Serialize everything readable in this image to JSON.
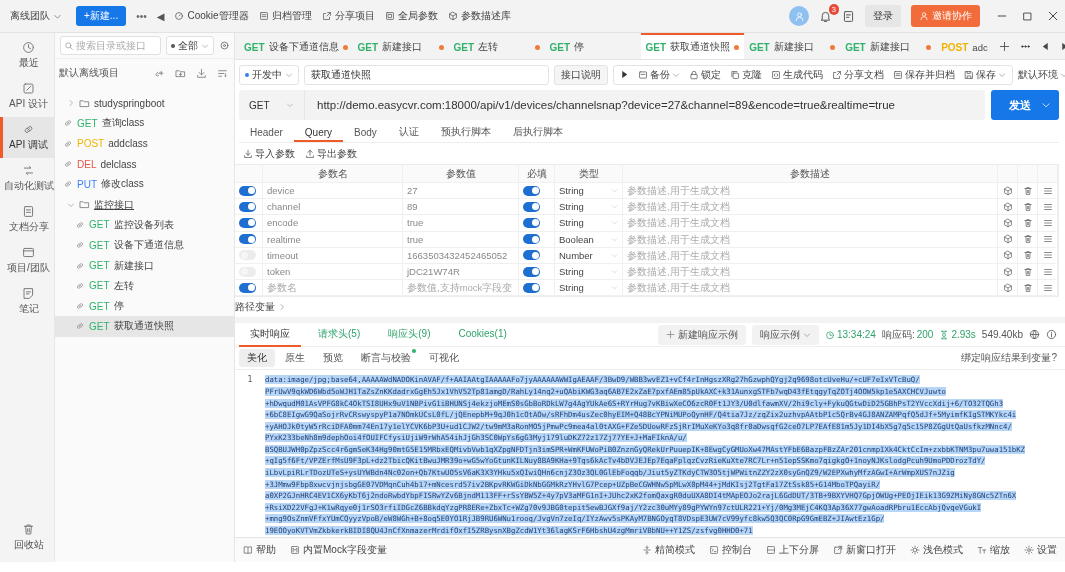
{
  "top_bar": {
    "team": "离线团队",
    "new_button": "+新建...",
    "more": "•••",
    "back": "◀",
    "menu": [
      "Cookie管理器",
      "归档管理",
      "分享项目",
      "全局参数",
      "参数描述库"
    ],
    "notification_count": "3",
    "login": "登录",
    "invite": "邀请协作"
  },
  "sidebar_rail": {
    "items": [
      {
        "label": "最近",
        "selected": false
      },
      {
        "label": "API 设计",
        "selected": false
      },
      {
        "label": "API 调试",
        "selected": true
      },
      {
        "label": "自动化测试",
        "selected": false
      },
      {
        "label": "文档分享",
        "selected": false
      },
      {
        "label": "项目/团队",
        "selected": false
      },
      {
        "label": "笔记",
        "selected": false
      }
    ],
    "bottom": "回收站"
  },
  "tree": {
    "search_placeholder": "搜索目录或接口",
    "filter": "全部",
    "project": "默认离线项目",
    "items": [
      {
        "kind": "folder",
        "name": "studyspringboot",
        "expanded": false
      },
      {
        "kind": "api",
        "method": "GET",
        "color": "#2fb36b",
        "name": "查询class",
        "selected": false
      },
      {
        "kind": "api",
        "method": "POST",
        "color": "#f0b400",
        "name": "addclass",
        "selected": false
      },
      {
        "kind": "api",
        "method": "DEL",
        "color": "#e0564b",
        "name": "delclass",
        "selected": false
      },
      {
        "kind": "api",
        "method": "PUT",
        "color": "#3b82f6",
        "name": "修改class",
        "selected": false
      },
      {
        "kind": "folder",
        "name": "监控接口",
        "expanded": true,
        "children": [
          {
            "kind": "api",
            "method": "GET",
            "color": "#2fb36b",
            "name": "监控设备列表",
            "selected": false
          },
          {
            "kind": "api",
            "method": "GET",
            "color": "#2fb36b",
            "name": "设备下通道信息",
            "selected": false
          },
          {
            "kind": "api",
            "method": "GET",
            "color": "#2fb36b",
            "name": "新建接口",
            "selected": false
          },
          {
            "kind": "api",
            "method": "GET",
            "color": "#2fb36b",
            "name": "左转",
            "selected": false
          },
          {
            "kind": "api",
            "method": "GET",
            "color": "#2fb36b",
            "name": "停",
            "selected": false
          },
          {
            "kind": "api",
            "method": "GET",
            "color": "#2fb36b",
            "name": "获取通道快照",
            "selected": true
          }
        ]
      }
    ]
  },
  "open_tabs": [
    {
      "method": "GET",
      "color": "#2fb36b",
      "name": "设备下通道信息",
      "unsaved": true,
      "selected": false
    },
    {
      "method": "GET",
      "color": "#2fb36b",
      "name": "新建接口",
      "unsaved": true,
      "selected": false
    },
    {
      "method": "GET",
      "color": "#2fb36b",
      "name": "左转",
      "unsaved": true,
      "selected": false
    },
    {
      "method": "GET",
      "color": "#2fb36b",
      "name": "停",
      "unsaved": false,
      "selected": false
    },
    {
      "method": "GET",
      "color": "#2fb36b",
      "name": "获取通道快照",
      "unsaved": true,
      "selected": true
    },
    {
      "method": "GET",
      "color": "#2fb36b",
      "name": "新建接口",
      "unsaved": true,
      "selected": false
    },
    {
      "method": "GET",
      "color": "#2fb36b",
      "name": "新建接口",
      "unsaved": true,
      "selected": false
    },
    {
      "method": "POST",
      "color": "#f0b400",
      "name": "adc",
      "unsaved": false,
      "selected": false
    }
  ],
  "request": {
    "status": "开发中",
    "name": "获取通道快照",
    "doc_button": "接口说明",
    "actions": [
      {
        "label": "备份",
        "dropdown": true
      },
      {
        "label": "锁定",
        "dropdown": false
      },
      {
        "label": "克隆",
        "dropdown": false
      },
      {
        "label": "生成代码",
        "dropdown": false
      },
      {
        "label": "分享文档",
        "dropdown": false
      },
      {
        "label": "保存并归档",
        "dropdown": false
      },
      {
        "label": "保存",
        "dropdown": true
      }
    ],
    "environment": "默认环境",
    "method": "GET",
    "url": "http://demo.easycvr.com:18000/api/v1/devices/channelsnap?device=27&channel=89&encode=true&realtime=true",
    "send": "发送",
    "tabs": [
      {
        "label": "Header",
        "selected": false
      },
      {
        "label": "Query",
        "selected": true
      },
      {
        "label": "Body",
        "selected": false
      },
      {
        "label": "认证",
        "selected": false
      },
      {
        "label": "预执行脚本",
        "selected": false
      },
      {
        "label": "后执行脚本",
        "selected": false
      }
    ],
    "param_tools": [
      "导入参数",
      "导出参数"
    ],
    "params": {
      "columns": [
        "参数名",
        "参数值",
        "必填",
        "类型",
        "参数描述"
      ],
      "rows": [
        {
          "enabled": true,
          "name": "device",
          "value": "27",
          "required": true,
          "type": "String",
          "description_placeholder": "参数描述,用于生成文档"
        },
        {
          "enabled": true,
          "name": "channel",
          "value": "89",
          "required": true,
          "type": "String",
          "description_placeholder": "参数描述,用于生成文档"
        },
        {
          "enabled": true,
          "name": "encode",
          "value": "true",
          "required": true,
          "type": "String",
          "description_placeholder": "参数描述,用于生成文档"
        },
        {
          "enabled": true,
          "name": "realtime",
          "value": "true",
          "required": true,
          "type": "Boolean",
          "description_placeholder": "参数描述,用于生成文档"
        },
        {
          "enabled": false,
          "name": "timeout",
          "value": "1663503432452465052",
          "required": true,
          "type": "Number",
          "description_placeholder": "参数描述,用于生成文档"
        },
        {
          "enabled": false,
          "name": "token",
          "value": "jDC21W74R",
          "required": true,
          "type": "String",
          "description_placeholder": "参数描述,用于生成文档"
        },
        {
          "enabled": true,
          "name_placeholder": "参数名",
          "value_placeholder": "参数值,支持mock字段变",
          "required": true,
          "type": "String",
          "description_placeholder": "参数描述,用于生成文档"
        }
      ]
    },
    "path_variables": "路径变量"
  },
  "response": {
    "tabs": [
      {
        "label": "实时响应",
        "selected": true
      },
      {
        "label": "请求头(5)",
        "selected": false
      },
      {
        "label": "响应头(9)",
        "selected": false
      },
      {
        "label": "Cookies(1)",
        "selected": false
      }
    ],
    "new_example": "新建响应示例",
    "example_select": "响应示例",
    "time": "13:34:24",
    "status_label": "响应码:",
    "status_code": "200",
    "duration": "2.93s",
    "size": "549.40kb",
    "view_tabs": [
      {
        "label": "美化",
        "selected": true,
        "badge": false
      },
      {
        "label": "原生",
        "selected": false,
        "badge": false
      },
      {
        "label": "预览",
        "selected": false,
        "badge": false
      },
      {
        "label": "断言与校验",
        "selected": false,
        "badge": true
      },
      {
        "label": "可视化",
        "selected": false,
        "badge": false
      }
    ],
    "bind_link": "绑定响应结果到变量?",
    "body": {
      "line_number": "1",
      "lines": [
        "data:image/jpg;base64,AAAAAWdNADOKinAVAF/f+AAIAAtgIAAAAAFo7jyAAAAAAWWIgAEAAF/3BwD9/WBB3wvEZ1+vCf4rInHgszXRg27hGzwphQYgj2q9698otcUveHu/+cUF7eIxVTcBuQ/",
        "PFrUwV9qkWD6Wbd5oWJH1TaZsZnKKdadrxGgEh5Jx1VhV52Tp81amgD/RahLy14nq2+uQAbiKWG3aq6AB7E2xZaE7pxfAEm85pUkAXC+k31AunxgSTFb7wqD43fEtqgyTqZOTj4OOW5kp1e5AXCHCVJuwto",
        "+hDwqudM01AsVPFG8kC4OkTSI8UHx9uV1NBPivG1iBHUNSj4ekzjoMEmS0sGbBoRDkLW7g4AgYUkAe6S+RYrHug7vKBiwXeCO6zcR0Ft1JY3/U0dlfawmXV/2hi9cly+FykuQGtwDiD25GBhPsT2YVccXdij+6/TO32TQGh3",
        "+6bC8EIgwG9QaSojrRvCRswyspyP1a7NOmkUCsL0fL/jQEnepbM+9qJ0h1cOtAOw/sRFhDm4usZec0hyEIM+Q48BcYPNiMUPoQynHF/Q4tia7Jz/zqZix2uzhvpAAtbP1c5QrBv4GJ8ANZAMPqfQ5dJf+5MyimfKIgSTMKYkc4i",
        "+yAHOJk0tyW5rRciDFA0mm74En17y1elYCVK6bP3U+ud1CJW2/tw9mM3aRonMO5jPmwPc9mea4al0tAXG+FZe5DUowRFzSjRrIMuXeKYo3q8fr0aDwsqfG2ceO7LP7EAfE81m5Jy1DI4bX5g7q5c15P8ZGgUtQaUsfkzMNnc4/",
        "PYxK233beNh8m9dephOoi4fOUIFCfysiUjiW9rWhA54ihJjGh3SC0WpYs6gG3Myj179luDKZ72z17Zj77YE+J+MaFIknA/u/",
        "BSQBUJWH0pZpzScc4r6gmSeK34Hg90mtG5E15MRbxEQMivbVwb1qXZpgNFDTjn3imSPR+WmKFUWoPiB0ZnznGyQRekUrPuuepIK+8EwgCyGMUoXw47MAstYFbE6BazpFBzZAr201cnmpIXk4CktCcIm+zxbbKTNM3pu7uwa151bKZ",
        "+qIg5f6Ft/VPZErfMsU9F3pL+dz2TbicQKitBwuJMR39o+wG5wYoGtunKILNuy8BA9KHa+9Tqs6kAcTv4bDVJEJEp7EqaFplqzCvzRieKuXte7RC7Lr+n51epSSKmo7qigkgO+1noyNJKslodgPcuh9UmoPDDrozTdY/",
        "iLbvLpiRLrTDozUTeS+ysUYWBdn4Nc02on+Qb7KtwUO5sV6aK3X3YHku5xQIwiQHn6cnjZ3Oz3QL0GlEbFoqqb/Jiut5yZTKdyCTW3O5tjWPWitnZZY2zX0syGnQZ9/W2EPXwhyMfzAGwI+ArWmpXUS7nJZig",
        "+3JMmw9Fbp8xwcvjnjsbgGE07VDMqnCuh4b17+mNcesrd57iv2BKpvRKWGiDkNbGGMkRzYHvlG7Pcep+UZpBeCGWHNw5pMLwX0pM44+jMdKIsj2TgtFa17ZtSsk85+G14MboTPQayiR/",
        "a0XP2GJnHRC4EV1CX6yKbT6j2ndoRwbdYbpFISRwYZv6BjndM113FF+rSsYBW5Z+4y7pV3aMFG1nI+JUhc2xK2fomQaxgR0duUXA8DI4tMApEOJo2rajL6GdDUT/3TB+9BXYVHQ7GpjOWUg+PEOjIEik13G9ZMiNy8GNc5ZTn6X",
        "+RsiXD22VFgJ+K1wRqye0j1rSO3rfiIDGcZ6BBkdqYzgPR8ERe+ZbxTc+WZg70v9JBG0tepit5ewBJGXf9aj/Y2zc30uMYy89gPYWYn97ctULR221+Yj/0Mg3MEjC4KQ3Ap36X77gwAoadRPbru1EccAbjQvqeVGukI",
        "+mng9OsZnmVFfxYUmCQyyzVpoB/eW8WGh+B+8oq5E0YO1RjJB9RU6WNu1rooq/JvgVn7zeIq/IYzAwv5sPKAyM7BNGOyqT8VDspE3UW7cV99yfc8kw5Q3QC0RpG9GmEBZ+JIAwtEz1Gp/",
        "19EOOyoKVTVmZkbkerkBIDI8QU4JnCfXnmazerMrdifOxfI5ZRBysnXBgZcdW1Yt36lagKSrF6HbshU4zgMmriVBbNU++Y1ZS/zsfvg0HHD0+71"
      ]
    }
  },
  "status_bar": {
    "left": [
      "帮助",
      "内置Mock字段变量"
    ],
    "right": [
      "精简模式",
      "控制台",
      "上下分屏",
      "新窗口打开",
      "浅色模式",
      "缩放",
      "设置"
    ]
  }
}
